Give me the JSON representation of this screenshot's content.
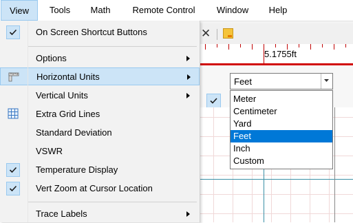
{
  "menubar": {
    "items": [
      "View",
      "Tools",
      "Math",
      "Remote Control",
      "Window",
      "Help"
    ]
  },
  "view_menu": {
    "items": [
      {
        "label": "On Screen Shortcut Buttons",
        "checked": true
      },
      {
        "label": "Options",
        "submenu": true
      },
      {
        "label": "Horizontal Units",
        "submenu": true,
        "highlighted": true,
        "icon": "ruler-icon"
      },
      {
        "label": "Vertical Units",
        "submenu": true
      },
      {
        "label": "Extra Grid Lines",
        "icon": "grid-icon"
      },
      {
        "label": "Standard Deviation"
      },
      {
        "label": "VSWR"
      },
      {
        "label": "Temperature Display",
        "checked": true
      },
      {
        "label": "Vert Zoom at Cursor Location",
        "checked": true
      },
      {
        "label": "Trace Labels",
        "submenu": true
      }
    ]
  },
  "ruler": {
    "value": "5.1755ft"
  },
  "units_select": {
    "selected": "Feet",
    "options": [
      "Meter",
      "Centimeter",
      "Yard",
      "Feet",
      "Inch",
      "Custom"
    ]
  },
  "colors": {
    "accent": "#0078d7",
    "highlight": "#cce4f7",
    "ruler_red": "#d00000",
    "grid_teal": "#3a8fa6"
  }
}
